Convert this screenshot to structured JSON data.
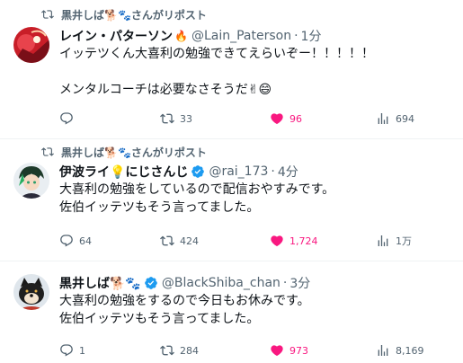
{
  "tweets": [
    {
      "repost_text": "黒井しば🐕🐾さんがリポスト",
      "name": "レイン・パターソン",
      "name_emoji": "🔥",
      "handle": "@Lain_Paterson",
      "time": "1分",
      "lines": [
        "イッテツくん大喜利の勉強できてえらいぞー！！！！！",
        "",
        "メンタルコーチは必要なさそうだ✌😄"
      ],
      "replies": "",
      "reposts": "33",
      "likes": "96",
      "views": "694"
    },
    {
      "repost_text": "黒井しば🐕🐾さんがリポスト",
      "name": "伊波ライ💡にじさんじ",
      "handle": "@rai_173",
      "time": "4分",
      "lines": [
        "大喜利の勉強をしているので配信おやすみです。",
        "佐伯イッテツもそう言ってました。"
      ],
      "replies": "64",
      "reposts": "424",
      "likes": "1,724",
      "views": "1万"
    },
    {
      "name": "黒井しば🐕🐾",
      "handle": "@BlackShiba_chan",
      "time": "3分",
      "lines": [
        "大喜利の勉強をするので今日もお休みです。",
        "佐伯イッテツもそう言ってました。"
      ],
      "replies": "1",
      "reposts": "284",
      "likes": "973",
      "views": "8,169"
    }
  ],
  "separator": "·",
  "colors": {
    "like": "#f91880",
    "muted": "#536471",
    "verified": "#1d9bf0"
  }
}
